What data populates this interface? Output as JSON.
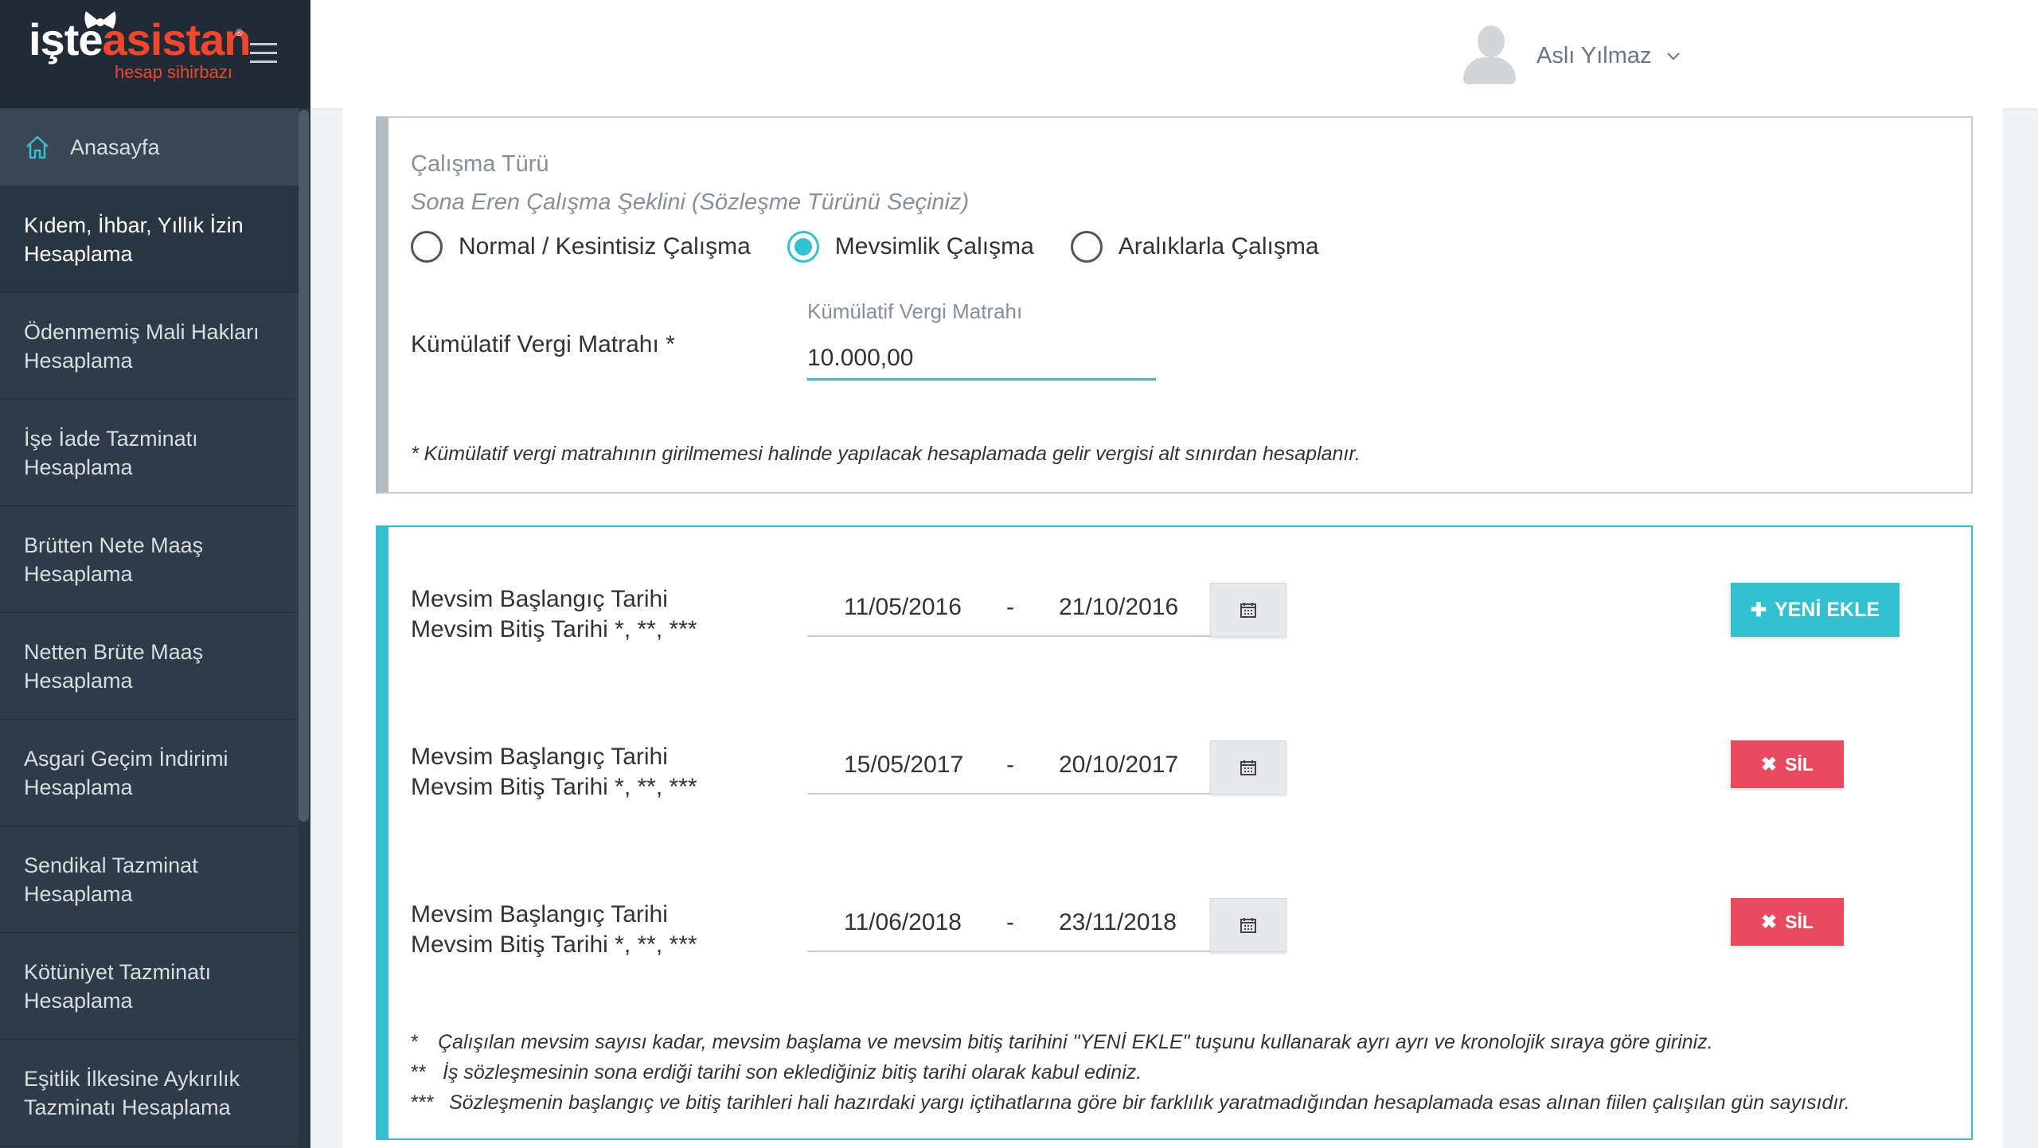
{
  "logo": {
    "brand_white": "işte",
    "brand_orange": "asistan",
    "registered": "®",
    "tagline": "hesap sihirbazı"
  },
  "header": {
    "user_name": "Aslı Yılmaz"
  },
  "sidebar": {
    "items": [
      {
        "label": "Anasayfa"
      },
      {
        "label": "Kıdem, İhbar, Yıllık İzin Hesaplama"
      },
      {
        "label": "Ödenmemiş Mali Hakları Hesaplama"
      },
      {
        "label": "İşe İade Tazminatı Hesaplama"
      },
      {
        "label": "Brütten Nete Maaş Hesaplama"
      },
      {
        "label": "Netten Brüte Maaş Hesaplama"
      },
      {
        "label": "Asgari Geçim İndirimi Hesaplama"
      },
      {
        "label": "Sendikal Tazminat Hesaplama"
      },
      {
        "label": "Kötüniyet Tazminatı Hesaplama"
      },
      {
        "label": "Eşitlik İlkesine Aykırılık Tazminatı Hesaplama"
      }
    ]
  },
  "work_type": {
    "title": "Çalışma Türü",
    "subtitle": "Sona Eren Çalışma Şeklini (Sözleşme Türünü Seçiniz)",
    "options": [
      {
        "label": "Normal / Kesintisiz Çalışma",
        "selected": false
      },
      {
        "label": "Mevsimlik Çalışma",
        "selected": true
      },
      {
        "label": "Aralıklarla Çalışma",
        "selected": false
      }
    ],
    "tax_base_label": "Kümülatif Vergi Matrahı *",
    "tax_base_float_label": "Kümülatif Vergi Matrahı",
    "tax_base_value": "10.000,00",
    "note": "* Kümülatif vergi matrahının girilmemesi halinde yapılacak hesaplamada gelir vergisi alt sınırdan hesaplanır."
  },
  "seasons": {
    "label_start": "Mevsim Başlangıç Tarihi",
    "label_end": "Mevsim Bitiş Tarihi *, **, ***",
    "rows": [
      {
        "start": "11/05/2016",
        "end": "21/10/2016"
      },
      {
        "start": "15/05/2017",
        "end": "20/10/2017"
      },
      {
        "start": "11/06/2018",
        "end": "23/11/2018"
      }
    ],
    "separator": "-",
    "add_label": "YENİ EKLE",
    "delete_label": "SİL",
    "notes": [
      {
        "mark": "*",
        "text": "Çalışılan mevsim sayısı kadar, mevsim başlama ve mevsim bitiş tarihini \"YENİ EKLE\" tuşunu kullanarak ayrı ayrı ve kronolojik sıraya göre giriniz."
      },
      {
        "mark": "**",
        "text": "İş sözleşmesinin sona erdiği tarihi son eklediğiniz bitiş tarihi olarak kabul ediniz."
      },
      {
        "mark": "***",
        "text": "Sözleşmenin başlangıç ve bitiş tarihleri hali hazırdaki yargı içtihatlarına göre bir farklılık yaratmadığından hesaplamada esas alınan fiilen çalışılan gün sayısıdır."
      }
    ]
  },
  "colors": {
    "accent": "#33c1cf",
    "danger": "#e84a5f",
    "brand_orange": "#f0462d",
    "sidebar_bg": "#2f3b47"
  },
  "icons": {
    "home": "home-icon",
    "calendar": "calendar-icon",
    "plus": "plus-icon",
    "times": "times-icon",
    "menu": "hamburger-icon",
    "chevron": "chevron-down-icon"
  }
}
